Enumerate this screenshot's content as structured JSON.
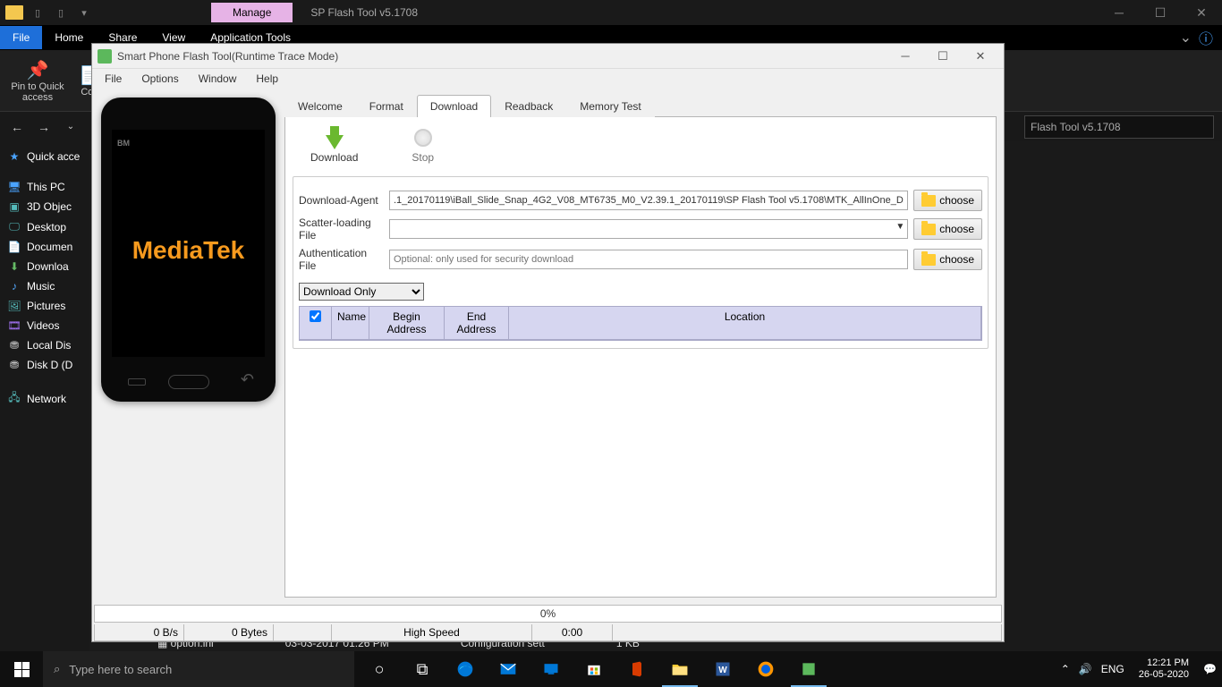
{
  "explorer": {
    "manage_tab": "Manage",
    "title": "SP Flash Tool v5.1708",
    "ribbon": {
      "file": "File",
      "tabs": [
        "Home",
        "Share",
        "View",
        "Application Tools"
      ]
    },
    "toolbar": {
      "pin": "Pin to Quick access",
      "copy": "Cop"
    },
    "address_right": "Flash Tool v5.1708",
    "sidebar": {
      "quick": "Quick acce",
      "thispc": "This PC",
      "items": [
        "3D Objec",
        "Desktop",
        "Documen",
        "Downloa",
        "Music",
        "Pictures",
        "Videos",
        "Local Dis",
        "Disk D (D"
      ],
      "network": "Network"
    },
    "file_peek": {
      "name": "option.ini",
      "date": "03-03-2017 01:26 PM",
      "type": "Configuration sett",
      "size": "1 KB"
    }
  },
  "spft": {
    "title": "Smart Phone Flash Tool(Runtime Trace Mode)",
    "menubar": [
      "File",
      "Options",
      "Window",
      "Help"
    ],
    "phone": {
      "bm": "BM",
      "brand": "MediaTek"
    },
    "tabs": [
      "Welcome",
      "Format",
      "Download",
      "Readback",
      "Memory Test"
    ],
    "active_tab": 2,
    "actions": {
      "download": "Download",
      "stop": "Stop"
    },
    "fields": {
      "da_label": "Download-Agent",
      "da_value": ".1_20170119\\iBall_Slide_Snap_4G2_V08_MT6735_M0_V2.39.1_20170119\\SP Flash Tool v5.1708\\MTK_AllInOne_DA.bin",
      "scatter_label": "Scatter-loading File",
      "scatter_value": "",
      "auth_label": "Authentication File",
      "auth_placeholder": "Optional: only used for security download",
      "choose": "choose"
    },
    "mode": "Download Only",
    "table_headers": {
      "name": "Name",
      "begin": "Begin Address",
      "end": "End Address",
      "location": "Location"
    },
    "progress": "0%",
    "status": {
      "rate": "0 B/s",
      "bytes": "0 Bytes",
      "mode": "High Speed",
      "time": "0:00"
    }
  },
  "taskbar": {
    "search_placeholder": "Type here to search",
    "lang": "ENG",
    "time": "12:21 PM",
    "date": "26-05-2020"
  }
}
